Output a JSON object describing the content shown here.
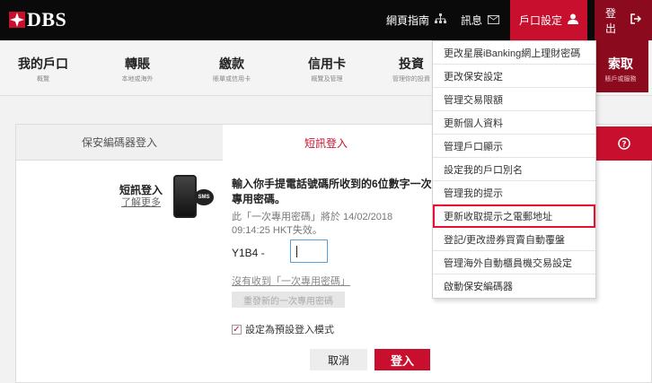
{
  "header": {
    "logo_text": "DBS",
    "links": {
      "site_guide": "網頁指南",
      "messages": "訊息",
      "account_settings": "戶口設定",
      "logout": "登出"
    },
    "brand_color": "#c8102e"
  },
  "mainnav": {
    "items": [
      {
        "title": "我的戶口",
        "sub": "概覽"
      },
      {
        "title": "轉賬",
        "sub": "本地或海外"
      },
      {
        "title": "繳款",
        "sub": "賬單或信用卡"
      },
      {
        "title": "信用卡",
        "sub": "概覽及管理"
      },
      {
        "title": "投資",
        "sub": "管理你的投資"
      },
      {
        "title": "索取",
        "sub": "賬戶或服務"
      }
    ]
  },
  "login": {
    "tab_token": "保安編碼器登入",
    "tab_sms": "短訊登入",
    "help_icon": "?",
    "sms_label": "短訊登入",
    "learn_more": "了解更多",
    "sms_badge": "SMS",
    "instruction": "輸入你手提電話號碼所收到的6位數字一次專用密碼。",
    "sent_note": "此「一次專用密碼」將於 14/02/2018 09:14:25 HKT失效。",
    "otp_prefix": "Y1B4 -",
    "otp_value": "",
    "not_received": "沒有收到「一次專用密碼」",
    "resend": "重發新的一次專用密碼",
    "default_mode": "設定為預設登入模式",
    "default_checked": true,
    "cancel": "取消",
    "submit": "登入"
  },
  "dropdown": {
    "items": [
      "更改星展iBanking網上理財密碼",
      "更改保安設定",
      "管理交易限額",
      "更新個人資料",
      "管理戶口顯示",
      "設定我的戶口別名",
      "管理我的提示",
      "更新收取提示之電郵地址",
      "登記/更改證券買賣自動覆盤",
      "管理海外自動櫃員機交易設定",
      "啟動保安編碼器"
    ],
    "highlighted_index": 7
  }
}
